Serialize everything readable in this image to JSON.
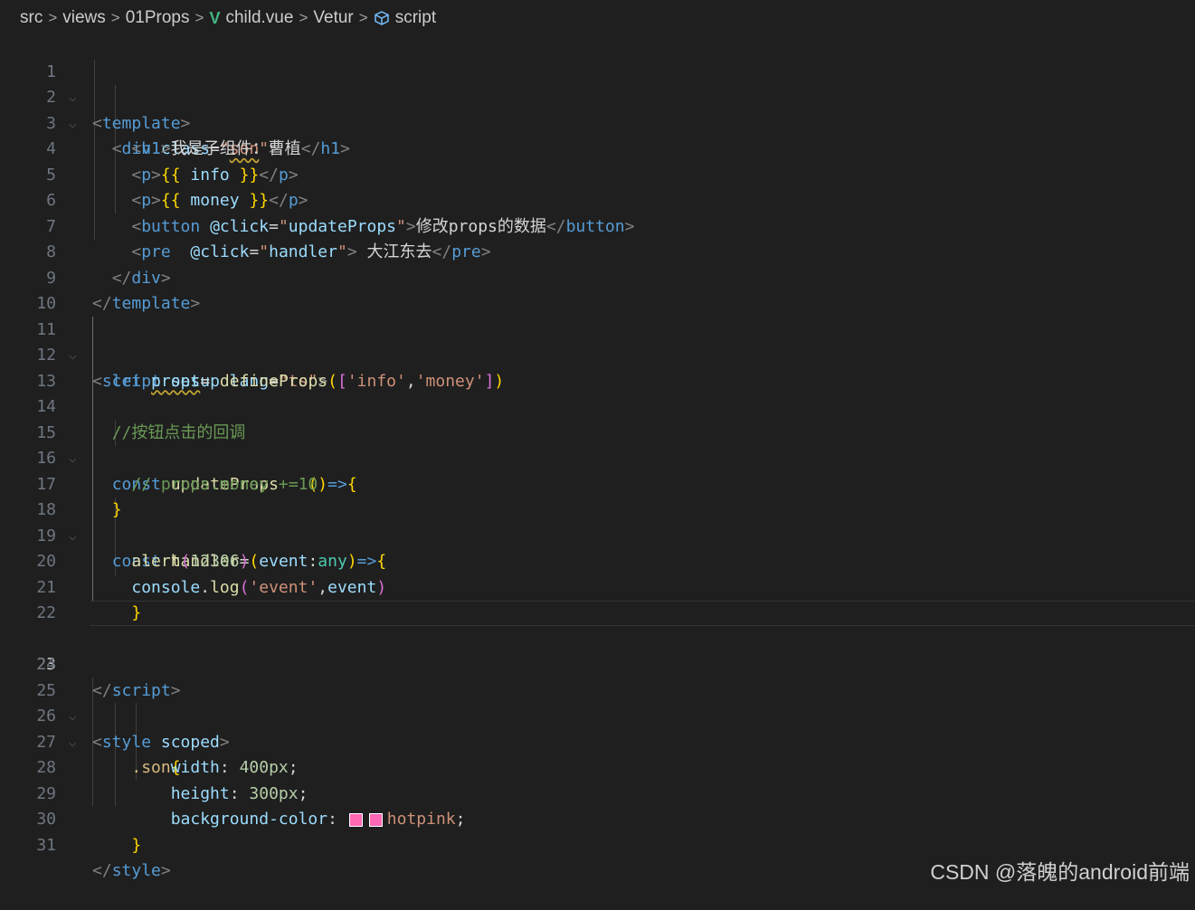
{
  "breadcrumb": {
    "items": [
      "src",
      "views",
      "01Props",
      "child.vue",
      "Vetur",
      "script"
    ],
    "separator": ">"
  },
  "editor": {
    "current_line": 23,
    "line_numbers": [
      "1",
      "2",
      "3",
      "4",
      "5",
      "6",
      "7",
      "8",
      "9",
      "10",
      "11",
      "12",
      "13",
      "14",
      "15",
      "16",
      "17",
      "18",
      "19",
      "20",
      "21",
      "22",
      "23",
      "24",
      "25",
      "26",
      "27",
      "28",
      "29",
      "30",
      "31"
    ],
    "swatch_color": "#ff69b4"
  },
  "code": {
    "l1": {
      "open": "<",
      "tag": "template",
      "close": ">"
    },
    "l2": {
      "open": "<",
      "tag": "div",
      "attr": "class",
      "eq": "=",
      "q1": "\"",
      "val": "son",
      "q2": "\"",
      "close": ">"
    },
    "l3": {
      "open": "<",
      "tag": "h1",
      "close": ">",
      "text": "我是子组件：曹植",
      "end_open": "</",
      "end_tag": "h1",
      "end_close": ">"
    },
    "l4": {
      "open": "<",
      "tag": "p",
      "close": ">",
      "mo": "{{",
      "expr": " info ",
      "mc": "}}",
      "end_open": "</",
      "end_tag": "p",
      "end_close": ">"
    },
    "l5": {
      "open": "<",
      "tag": "p",
      "close": ">",
      "mo": "{{",
      "expr": " money ",
      "mc": "}}",
      "end_open": "</",
      "end_tag": "p",
      "end_close": ">"
    },
    "l6": {
      "open": "<",
      "tag": "button",
      "attr": "@click",
      "eq": "=",
      "q1": "\"",
      "val": "updateProps",
      "q2": "\"",
      "close": ">",
      "text": "修改props的数据",
      "end_open": "</",
      "end_tag": "button",
      "end_close": ">"
    },
    "l7": {
      "open": "<",
      "tag": "pre",
      "sp": "  ",
      "attr": "@click",
      "eq": "=",
      "q1": "\"",
      "val": "handler",
      "q2": "\"",
      "close": ">",
      "text": " 大江东去",
      "end_open": "</",
      "end_tag": "pre",
      "end_close": ">"
    },
    "l8": {
      "open": "</",
      "tag": "div",
      "close": ">"
    },
    "l9": {
      "open": "</",
      "tag": "template",
      "close": ">"
    },
    "l11": {
      "open": "<",
      "tag": "script",
      "attr1": "setup",
      "attr2": "lang",
      "eq": "=",
      "val": "\"ts\"",
      "close": ">"
    },
    "l12": {
      "kw": "let",
      "var": "props",
      "op": "= ",
      "fn": "defineProps",
      "p1": "(",
      "b1": "[",
      "s1": "'info'",
      "comma": ",",
      "s2": "'money'",
      "b2": "]",
      "p2": ")"
    },
    "l14": {
      "comment": "//按钮点击的回调"
    },
    "l15": {
      "kw": "const",
      "fn": "updateProps",
      "op": " = ",
      "p1": "(",
      "p2": ")",
      "arrow": "=>",
      "b1": "{"
    },
    "l16": {
      "comment": "// props.money +=10"
    },
    "l17": {
      "b1": "}"
    },
    "l18": {
      "kw": "const",
      "fn": "handler",
      "op": "=",
      "p1": "(",
      "param": "event",
      "colon": ":",
      "type": "any",
      "p2": ")",
      "arrow": "=>",
      "b1": "{"
    },
    "l19": {
      "fn": "alert",
      "p1": "(",
      "num": "12306",
      "p2": ")"
    },
    "l20": {
      "obj": "console",
      "dot": ".",
      "fn": "log",
      "p1": "(",
      "str": "'event'",
      "comma": ",",
      "var": "event",
      "p2": ")"
    },
    "l21": {
      "b1": "}"
    },
    "l23": {
      "open": "</",
      "tag": "script",
      "close": ">"
    },
    "l25": {
      "open": "<",
      "tag": "style",
      "attr": "scoped",
      "close": ">"
    },
    "l26": {
      "sel": ".son",
      "b1": "{"
    },
    "l27": {
      "prop": "width",
      "colon": ": ",
      "val": "400px",
      "semi": ";"
    },
    "l28": {
      "prop": "height",
      "colon": ": ",
      "val": "300px",
      "semi": ";"
    },
    "l29": {
      "prop": "background-color",
      "colon": ": ",
      "val": "hotpink",
      "semi": ";"
    },
    "l30": {
      "b1": "}"
    },
    "l31": {
      "open": "</",
      "tag": "style",
      "close": ">"
    }
  },
  "watermark": "CSDN @落魄的android前端"
}
